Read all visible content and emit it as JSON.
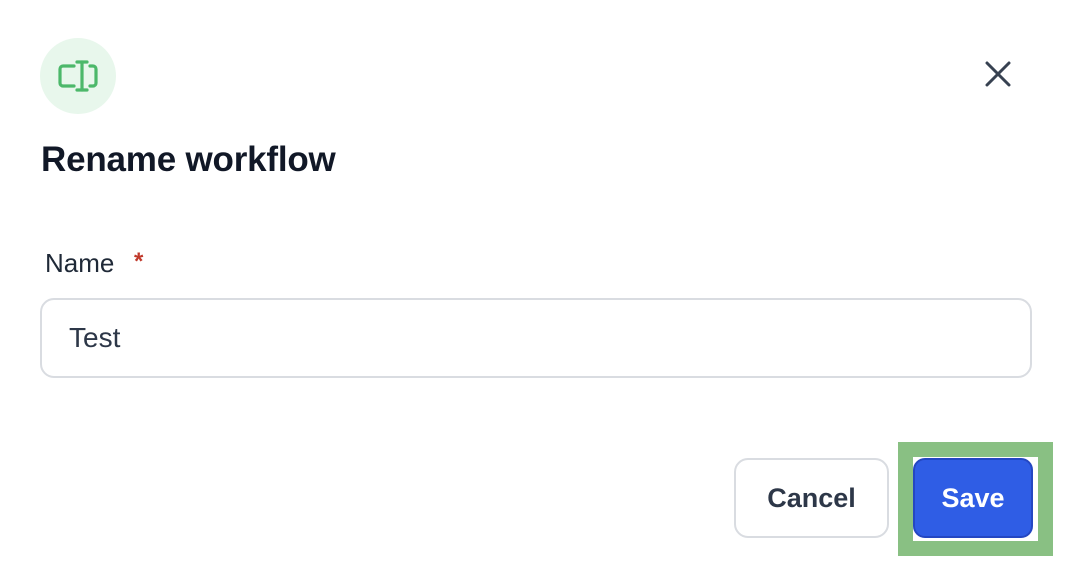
{
  "dialog": {
    "title": "Rename workflow",
    "header_icon": "rename-field-icon",
    "close_icon": "close-icon",
    "accent_color": "#4cb86a"
  },
  "form": {
    "name_label": "Name",
    "required_mark": "*",
    "name_value": "Test"
  },
  "actions": {
    "cancel_label": "Cancel",
    "save_label": "Save",
    "save_color": "#2f5de5",
    "highlight_color": "#89c083"
  }
}
